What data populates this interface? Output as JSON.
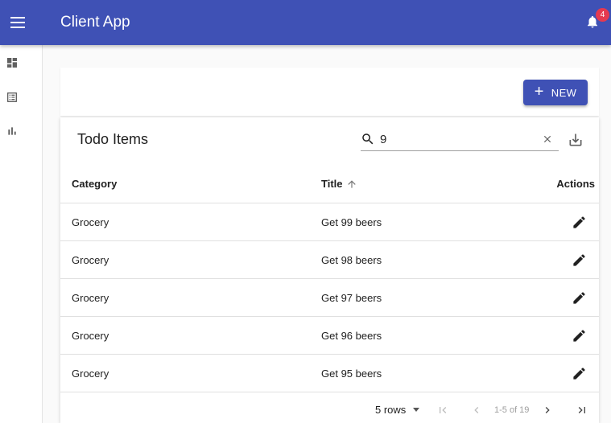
{
  "appbar": {
    "title": "Client App",
    "notification_count": "4",
    "icons": [
      "menu-icon",
      "bell-icon"
    ]
  },
  "sidebar": {
    "items": [
      {
        "icon": "dashboard-icon"
      },
      {
        "icon": "list-icon"
      },
      {
        "icon": "bar-chart-icon"
      }
    ]
  },
  "toolbar": {
    "new_label": "NEW"
  },
  "table": {
    "title": "Todo Items",
    "search_value": "9",
    "columns": {
      "category": "Category",
      "title": "Title",
      "actions": "Actions"
    },
    "sort": {
      "column": "title",
      "direction": "ascending"
    },
    "rows": [
      {
        "category": "Grocery",
        "title": "Get 99 beers"
      },
      {
        "category": "Grocery",
        "title": "Get 98 beers"
      },
      {
        "category": "Grocery",
        "title": "Get 97 beers"
      },
      {
        "category": "Grocery",
        "title": "Get 96 beers"
      },
      {
        "category": "Grocery",
        "title": "Get 95 beers"
      }
    ],
    "pagination": {
      "rows_per_page": "5 rows",
      "info": "1-5 of 19"
    }
  },
  "colors": {
    "primary": "#3f51b5",
    "badge": "#e53950"
  }
}
